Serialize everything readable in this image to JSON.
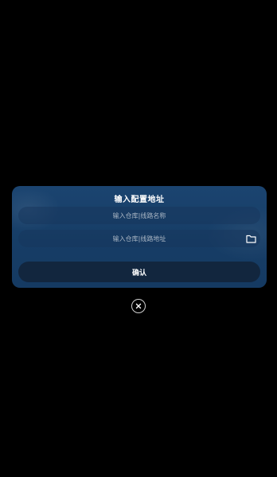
{
  "dialog": {
    "title": "输入配置地址",
    "name_input": {
      "placeholder": "输入仓库|线路名称",
      "value": ""
    },
    "url_input": {
      "placeholder": "输入仓库|线路地址",
      "value": ""
    },
    "folder_icon": "folder-icon",
    "confirm_label": "确认"
  },
  "close_icon": "close-icon",
  "colors": {
    "background": "#000000",
    "dialog": "#1b4470",
    "input": "#18375c",
    "button": "#12263e",
    "text": "#ffffff",
    "placeholder": "#aab6c4"
  }
}
